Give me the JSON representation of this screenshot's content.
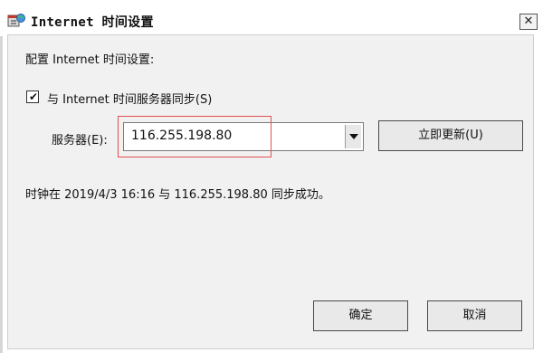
{
  "window": {
    "title": "Internet 时间设置",
    "close_label": "✕"
  },
  "content": {
    "configure_label": "配置 Internet 时间设置:",
    "sync_checkbox_label": "与 Internet 时间服务器同步(S)",
    "sync_checked": true,
    "server_label": "服务器(E):",
    "server_value": "116.255.198.80",
    "update_button_label": "立即更新(U)",
    "status_text": "时钟在 2019/4/3 16:16 与 116.255.198.80 同步成功。"
  },
  "buttons": {
    "ok_label": "确定",
    "cancel_label": "取消"
  },
  "colors": {
    "highlight_border": "#e05050",
    "window_bg": "#f1f1f1"
  },
  "icons": {
    "title_icon": "datetime-globe-icon",
    "dropdown_icon": "chevron-down-icon",
    "check_icon": "check-icon"
  }
}
